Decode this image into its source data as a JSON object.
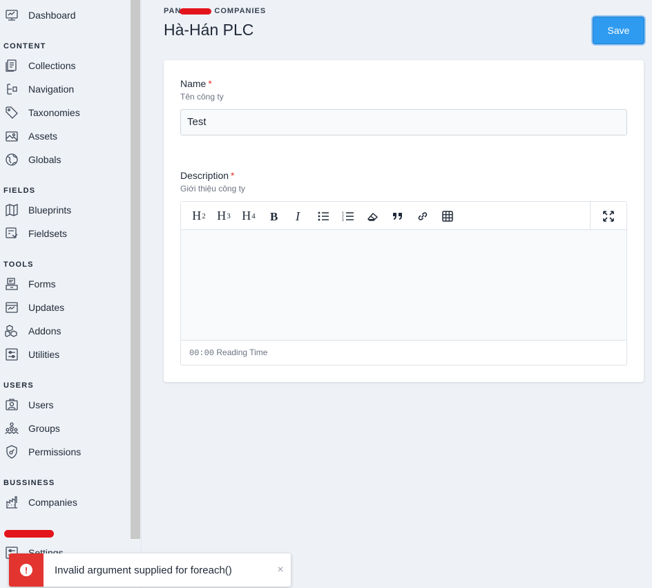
{
  "sidebar": {
    "top": {
      "label": "Dashboard",
      "icon": "dashboard-icon"
    },
    "sections": [
      {
        "title": "CONTENT",
        "items": [
          {
            "label": "Collections",
            "icon": "collections-icon"
          },
          {
            "label": "Navigation",
            "icon": "navigation-icon"
          },
          {
            "label": "Taxonomies",
            "icon": "tag-icon"
          },
          {
            "label": "Assets",
            "icon": "image-icon"
          },
          {
            "label": "Globals",
            "icon": "globe-icon"
          }
        ]
      },
      {
        "title": "FIELDS",
        "items": [
          {
            "label": "Blueprints",
            "icon": "blueprint-icon"
          },
          {
            "label": "Fieldsets",
            "icon": "fieldset-icon"
          }
        ]
      },
      {
        "title": "TOOLS",
        "items": [
          {
            "label": "Forms",
            "icon": "form-icon"
          },
          {
            "label": "Updates",
            "icon": "updates-icon"
          },
          {
            "label": "Addons",
            "icon": "addons-icon"
          },
          {
            "label": "Utilities",
            "icon": "utilities-icon"
          }
        ]
      },
      {
        "title": "USERS",
        "items": [
          {
            "label": "Users",
            "icon": "user-icon"
          },
          {
            "label": "Groups",
            "icon": "groups-icon"
          },
          {
            "label": "Permissions",
            "icon": "permissions-icon"
          }
        ]
      },
      {
        "title": "BUSSINESS",
        "items": [
          {
            "label": "Companies",
            "icon": "companies-icon"
          }
        ]
      }
    ],
    "bottom_item": {
      "label": "Settings",
      "icon": "settings-icon"
    }
  },
  "header": {
    "breadcrumb_prefix": "PAN",
    "breadcrumb_current": "COMPANIES",
    "title": "Hà-Hán PLC",
    "save_label": "Save"
  },
  "form": {
    "name": {
      "label": "Name",
      "required_mark": "*",
      "help": "Tên công ty",
      "value": "Test"
    },
    "description": {
      "label": "Description",
      "required_mark": "*",
      "help": "Giới thiệu công ty",
      "toolbar": {
        "h2": "H",
        "h2_sub": "2",
        "h3": "H",
        "h3_sub": "3",
        "h4": "H",
        "h4_sub": "4"
      },
      "reading_time": "00:00",
      "reading_label": "Reading Time"
    }
  },
  "toast": {
    "type": "error",
    "icon": "!",
    "message": "Invalid argument supplied for foreach()",
    "close": "×"
  },
  "colors": {
    "accent": "#2f9bf0",
    "error": "#e3342f",
    "background": "#eef1f6"
  }
}
